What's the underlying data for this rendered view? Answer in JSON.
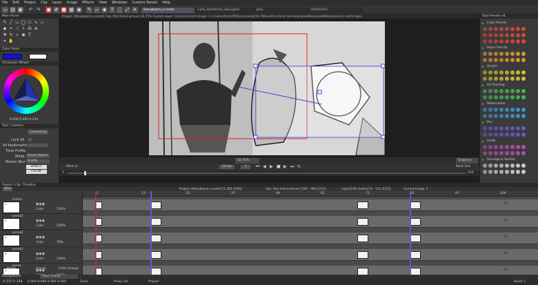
{
  "menu": [
    "File",
    "Edit",
    "Project",
    "Clip",
    "Layer",
    "Image",
    "Effects",
    "View",
    "Windows",
    "Custom Panels",
    "Help"
  ],
  "tabs": [
    {
      "label": "Storyboard_e-conte",
      "active": true
    },
    {
      "label": "Lady_Borderline_Bauxgifes",
      "active": false
    },
    {
      "label": "Jelly",
      "active": false
    },
    {
      "label": "Untitled(1)",
      "active": false
    }
  ],
  "canvas": {
    "path": "Project: [Storyboard_e-conte]  Clip: [the friend arrives]  32.75%  Current Layer: [indiro]  Current Image: 1 3 (Users/[User/PP/Documents/[To:70Pencil/Contents and examples/Storyboard/Storyboard_e-conte.tvpp]"
  },
  "left_panel": {
    "main_panel": "Main Panel",
    "color_panel": "Color Panel",
    "chromatic_wheel": "Chromatic Wheel",
    "color_value": "0.000 0.000 0.255",
    "tool_camera": "Tool : Camera",
    "contextual": "Contextual",
    "lock_all": "Lock All",
    "bookmarks": "All bookmarks",
    "time_profile": "Time Profile",
    "mode": "Mode",
    "mode_value": "Smart Spline",
    "motion_blur": "Motion Blur",
    "motion_blur_value": "0.00%",
    "pos_x": "1656.9",
    "pos_y": "750.98"
  },
  "right_panel": {
    "title": "Tool Presets v4",
    "sections": [
      "Color Pencils",
      "Paper Pencils",
      "Acrylic",
      "Oil Painting",
      "Watercolour",
      "Pen",
      "Chalk",
      "Smudge & Spread"
    ],
    "section_colors": [
      "#e64a3c",
      "#f0a030",
      "#e0d030",
      "#4ac060",
      "#3aa0e0",
      "#6a60d8",
      "#c050c0",
      "#dddddd"
    ]
  },
  "canvas_controls": {
    "mark_in": "Mark In",
    "mark_out": "Mark Out",
    "fps": "24 fps",
    "frame": "1",
    "zoom": "32.75%",
    "display": "Graphics",
    "start_frame": "1",
    "end_frame": "125"
  },
  "timeline": {
    "title": "Project: Clip: Timeline",
    "new_label": "New",
    "info": [
      "Project: [Storyboard_e-conte] [1 350 (559)]",
      "Clip: [the friend arrives] [105 - 360 (111)]",
      "Layer[1/9]: [indiro] [1 - 111 (111)]",
      "Current Image: 1"
    ],
    "ruler": [
      "1",
      "13",
      "25",
      "37",
      "49",
      "61",
      "73",
      "85",
      "97",
      "109"
    ],
    "layers": [
      {
        "name": "instiro",
        "mode": "Color",
        "opacity": "100%"
      },
      {
        "name": "perso2",
        "mode": "Color",
        "opacity": "100%"
      },
      {
        "name": "perso2",
        "mode": "Color",
        "opacity": "78%"
      },
      {
        "name": "perso2",
        "mode": "Color",
        "opacity": "100%"
      },
      {
        "name": "perso",
        "mode": "Color",
        "opacity": "100%"
      }
    ],
    "track_numbers": [
      "25",
      "43",
      "35",
      "43",
      "43"
    ],
    "bottom_tabs": [
      "Notes",
      "Sound",
      "Color Groups"
    ],
    "background": "Background",
    "start_frame": "Start Frame"
  },
  "status": {
    "coords": "X:352  Y:-148",
    "color": "0.000 0.000 0.000 A:000",
    "color_label": "Color",
    "proxy": "Proxy  2%",
    "project": "Project",
    "room": "Room 1"
  }
}
